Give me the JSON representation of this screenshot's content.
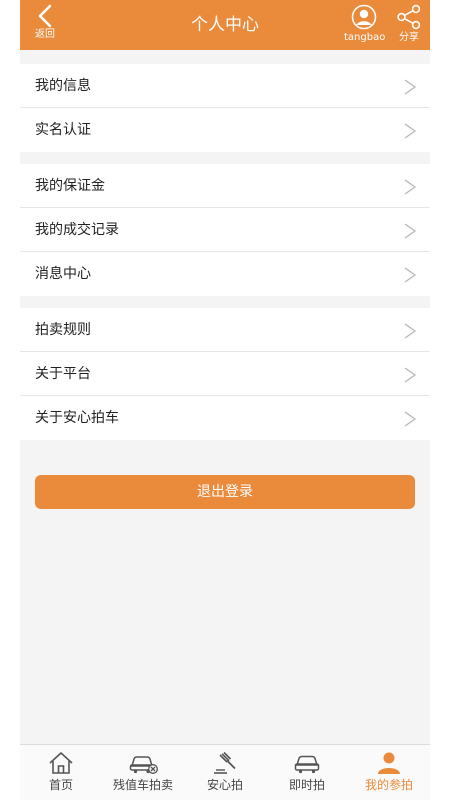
{
  "header": {
    "back_label": "返回",
    "title": "个人中心",
    "username": "tangbao",
    "share_label": "分享"
  },
  "menu": {
    "group1": [
      "我的信息",
      "实名认证"
    ],
    "group2": [
      "我的保证金",
      "我的成交记录",
      "消息中心"
    ],
    "group3": [
      "拍卖规则",
      "关于平台",
      "关于安心拍车"
    ]
  },
  "logout_label": "退出登录",
  "tabs": [
    {
      "label": "首页",
      "icon": "home-icon"
    },
    {
      "label": "残值车拍卖",
      "icon": "damaged-car-icon"
    },
    {
      "label": "安心拍",
      "icon": "gavel-icon"
    },
    {
      "label": "即时拍",
      "icon": "car-icon"
    },
    {
      "label": "我的参拍",
      "icon": "person-icon",
      "active": true
    }
  ],
  "colors": {
    "accent": "#ea8a3b",
    "background": "#f4f4f4"
  }
}
